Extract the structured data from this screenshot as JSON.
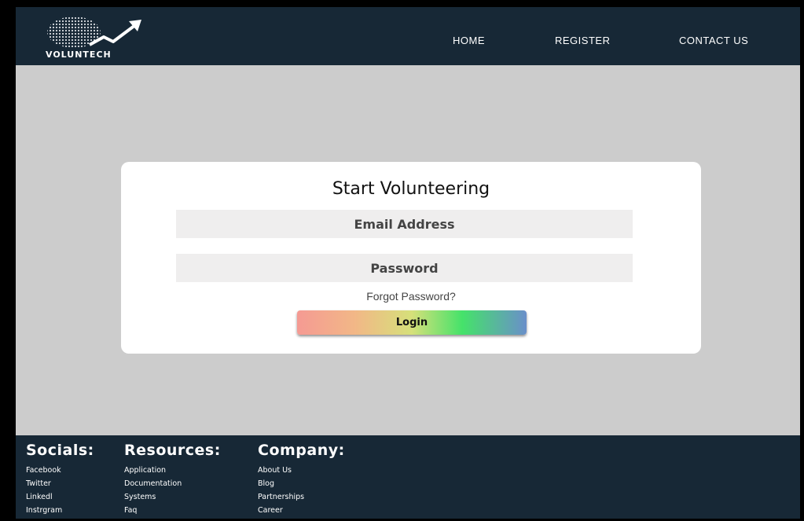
{
  "header": {
    "logo_text": "VOLUNTECH",
    "nav": [
      {
        "label": "HOME"
      },
      {
        "label": "REGISTER"
      },
      {
        "label": "CONTACT US"
      }
    ]
  },
  "login_card": {
    "title": "Start Volunteering",
    "email_placeholder": "Email Address",
    "password_placeholder": "Password",
    "forgot_label": "Forgot Password?",
    "login_label": "Login"
  },
  "footer": {
    "columns": [
      {
        "heading": "Socials:",
        "links": [
          "Facebook",
          "Twitter",
          "Linkedl",
          "Instrgram"
        ]
      },
      {
        "heading": "Resources:",
        "links": [
          "Application",
          "Documentation",
          "Systems",
          "Faq"
        ]
      },
      {
        "heading": "Company:",
        "links": [
          "About Us",
          "Blog",
          "Partnerships",
          "Career"
        ]
      }
    ]
  },
  "colors": {
    "header_bg": "#172836",
    "page_bg": "#cccccc",
    "card_bg": "#ffffff",
    "field_bg": "#efeeee"
  },
  "icons": {
    "logo": "globe-arrow-logo-icon"
  }
}
